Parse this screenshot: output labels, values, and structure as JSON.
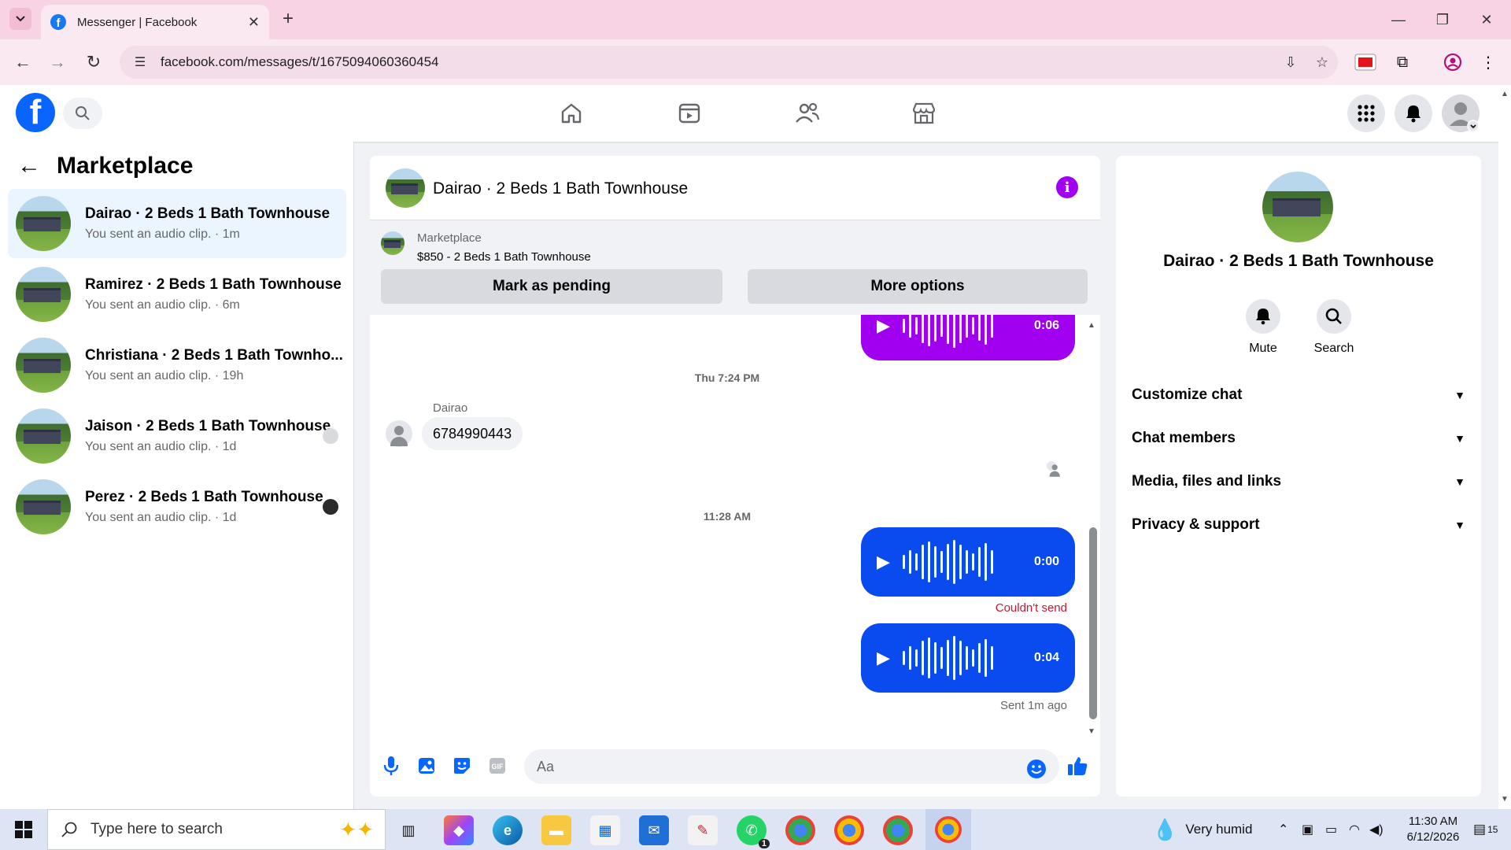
{
  "browser": {
    "tab_title": "Messenger | Facebook",
    "url": "facebook.com/messages/t/1675094060360454"
  },
  "left": {
    "title": "Marketplace",
    "conversations": [
      {
        "name": "Dairao · 2 Beds 1 Bath Townhouse",
        "sub": "You sent an audio clip. · 1m",
        "active": true
      },
      {
        "name": "Ramirez · 2 Beds 1 Bath Townhouse",
        "sub": "You sent an audio clip. · 6m"
      },
      {
        "name": "Christiana · 2 Beds 1 Bath Townho...",
        "sub": "You sent an audio clip. · 19h"
      },
      {
        "name": "Jaison · 2 Beds 1 Bath Townhouse",
        "sub": "You sent an audio clip. · 1d"
      },
      {
        "name": "Perez · 2 Beds 1 Bath Townhouse",
        "sub": "You sent an audio clip. · 1d"
      }
    ]
  },
  "chat": {
    "title": "Dairao · 2 Beds 1 Bath Townhouse",
    "listing_label": "Marketplace",
    "listing_price": "$850 - 2 Beds 1 Bath Townhouse",
    "mark_pending": "Mark as pending",
    "more_options": "More options",
    "audio1_duration": "0:06",
    "timestamp1": "Thu 7:24 PM",
    "sender_name": "Dairao",
    "incoming_message": "6784990443",
    "timestamp2": "11:28 AM",
    "audio2_duration": "0:00",
    "audio2_status": "Couldn't send",
    "audio3_duration": "0:04",
    "audio3_status": "Sent 1m ago",
    "input_placeholder": "Aa",
    "brand_color": "#0866ff",
    "accent_purple": "#a100f0",
    "bubble_blue": "#0a4bf0"
  },
  "right": {
    "name": "Dairao · 2 Beds 1 Bath Townhouse",
    "mute": "Mute",
    "search": "Search",
    "sections": [
      "Customize chat",
      "Chat members",
      "Media, files and links",
      "Privacy & support"
    ]
  },
  "taskbar": {
    "search_placeholder": "Type here to search",
    "weather": "Very humid",
    "time": "11:30 AM",
    "date": "6/12/2026",
    "whatsapp_badge": "1",
    "notifications": "15"
  }
}
